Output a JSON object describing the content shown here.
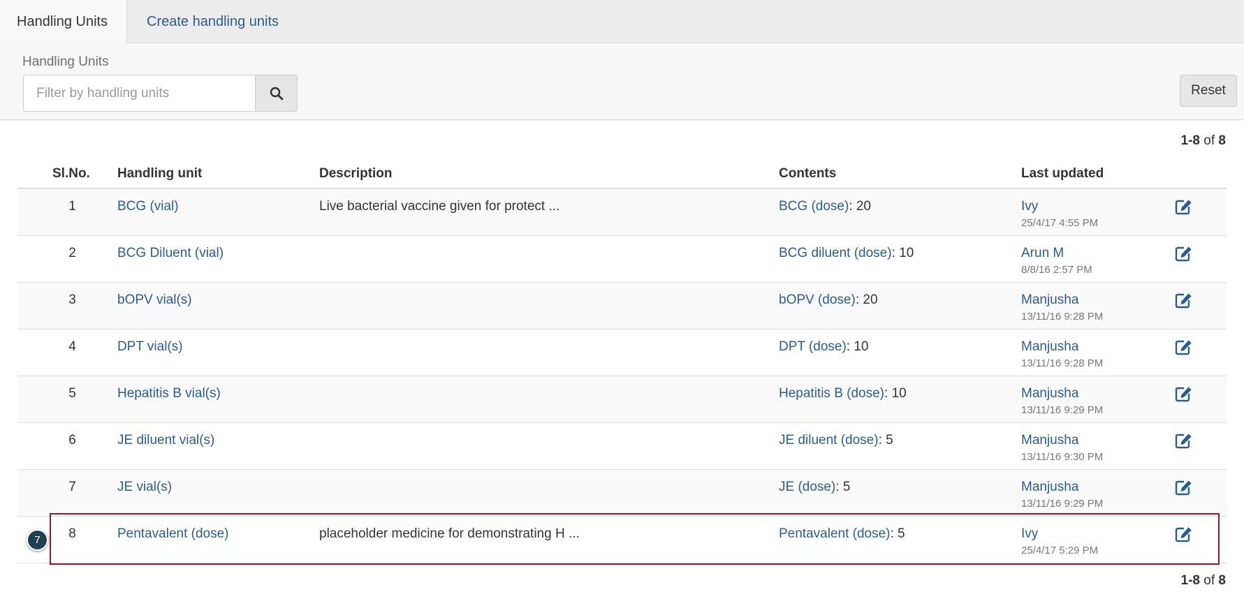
{
  "tabs": [
    {
      "label": "Handling Units",
      "active": true
    },
    {
      "label": "Create handling units",
      "active": false
    }
  ],
  "filter": {
    "label": "Handling Units",
    "placeholder": "Filter by handling units",
    "search_icon": "search-icon",
    "reset_label": "Reset"
  },
  "pagination": {
    "range": "1-8",
    "of_label": "of",
    "total": "8"
  },
  "table": {
    "headers": {
      "no": "Sl.No.",
      "unit": "Handling unit",
      "description": "Description",
      "contents": "Contents",
      "updated": "Last updated"
    },
    "rows": [
      {
        "no": "1",
        "unit": "BCG (vial)",
        "description": "Live bacterial vaccine given for protect ...",
        "content_name": "BCG (dose)",
        "content_qty": ": 20",
        "user": "Ivy",
        "time": "25/4/17 4:55 PM"
      },
      {
        "no": "2",
        "unit": "BCG Diluent (vial)",
        "description": "",
        "content_name": "BCG diluent (dose)",
        "content_qty": ": 10",
        "user": "Arun M",
        "time": "8/8/16 2:57 PM"
      },
      {
        "no": "3",
        "unit": "bOPV vial(s)",
        "description": "",
        "content_name": "bOPV (dose)",
        "content_qty": ": 20",
        "user": "Manjusha",
        "time": "13/11/16 9:28 PM"
      },
      {
        "no": "4",
        "unit": "DPT vial(s)",
        "description": "",
        "content_name": "DPT (dose)",
        "content_qty": ": 10",
        "user": "Manjusha",
        "time": "13/11/16 9:28 PM"
      },
      {
        "no": "5",
        "unit": "Hepatitis B vial(s)",
        "description": "",
        "content_name": "Hepatitis B (dose)",
        "content_qty": ": 10",
        "user": "Manjusha",
        "time": "13/11/16 9:29 PM"
      },
      {
        "no": "6",
        "unit": "JE diluent vial(s)",
        "description": "",
        "content_name": "JE diluent (dose)",
        "content_qty": ": 5",
        "user": "Manjusha",
        "time": "13/11/16 9:30 PM"
      },
      {
        "no": "7",
        "unit": "JE vial(s)",
        "description": "",
        "content_name": "JE (dose)",
        "content_qty": ": 5",
        "user": "Manjusha",
        "time": "13/11/16 9:29 PM"
      },
      {
        "no": "8",
        "unit": "Pentavalent (dose)",
        "description": "placeholder medicine for demonstrating H ...",
        "content_name": "Pentavalent (dose)",
        "content_qty": ": 5",
        "user": "Ivy",
        "time": "25/4/17 5:29 PM"
      }
    ],
    "row_action_icon": "edit-icon"
  },
  "annotation": {
    "step": "7"
  },
  "colors": {
    "link": "#2a5d8f",
    "highlight": "#8b1e22",
    "badge": "#1f3f55"
  }
}
